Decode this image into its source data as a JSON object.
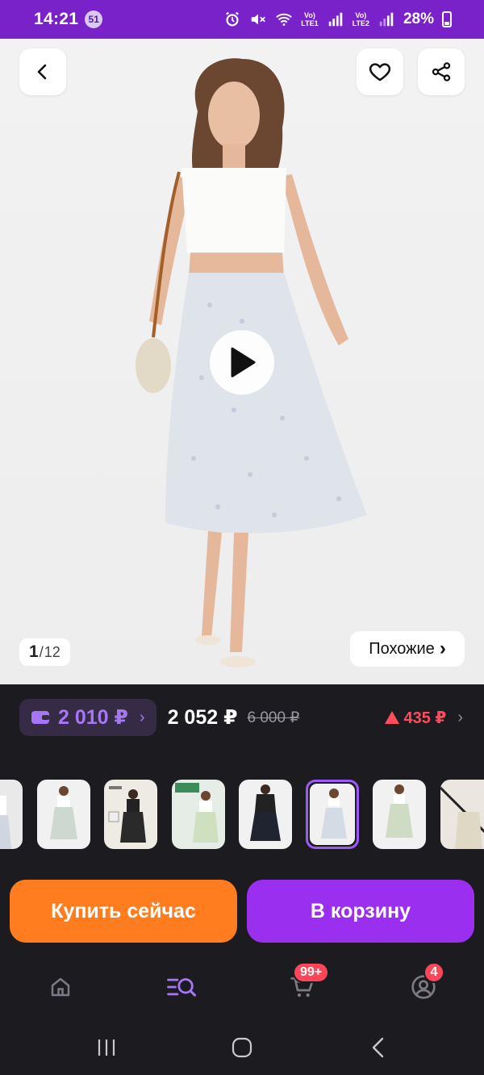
{
  "status_bar": {
    "time": "14:21",
    "notification_count": "51",
    "battery": "28%",
    "sim1": "LTE1",
    "sim2": "LTE2"
  },
  "gallery": {
    "current_page": "1",
    "separator": "/",
    "total_pages": "12",
    "similar_label": "Похожие",
    "similar_arrow": "›"
  },
  "price": {
    "wallet_price": "2 010 ₽",
    "wallet_arrow": "›",
    "price": "2 052 ₽",
    "old_price": "6 000 ₽",
    "price_change": "435 ₽",
    "details_arrow": "›"
  },
  "actions": {
    "buy_now": "Купить сейчас",
    "add_to_cart": "В корзину"
  },
  "tabs": {
    "cart_badge": "99+",
    "profile_badge": "4"
  },
  "colors": {
    "accent": "#9b2ff0",
    "buy": "#ff7d1f",
    "status_bar": "#7a22c9",
    "price_up": "#ff4b5c"
  }
}
